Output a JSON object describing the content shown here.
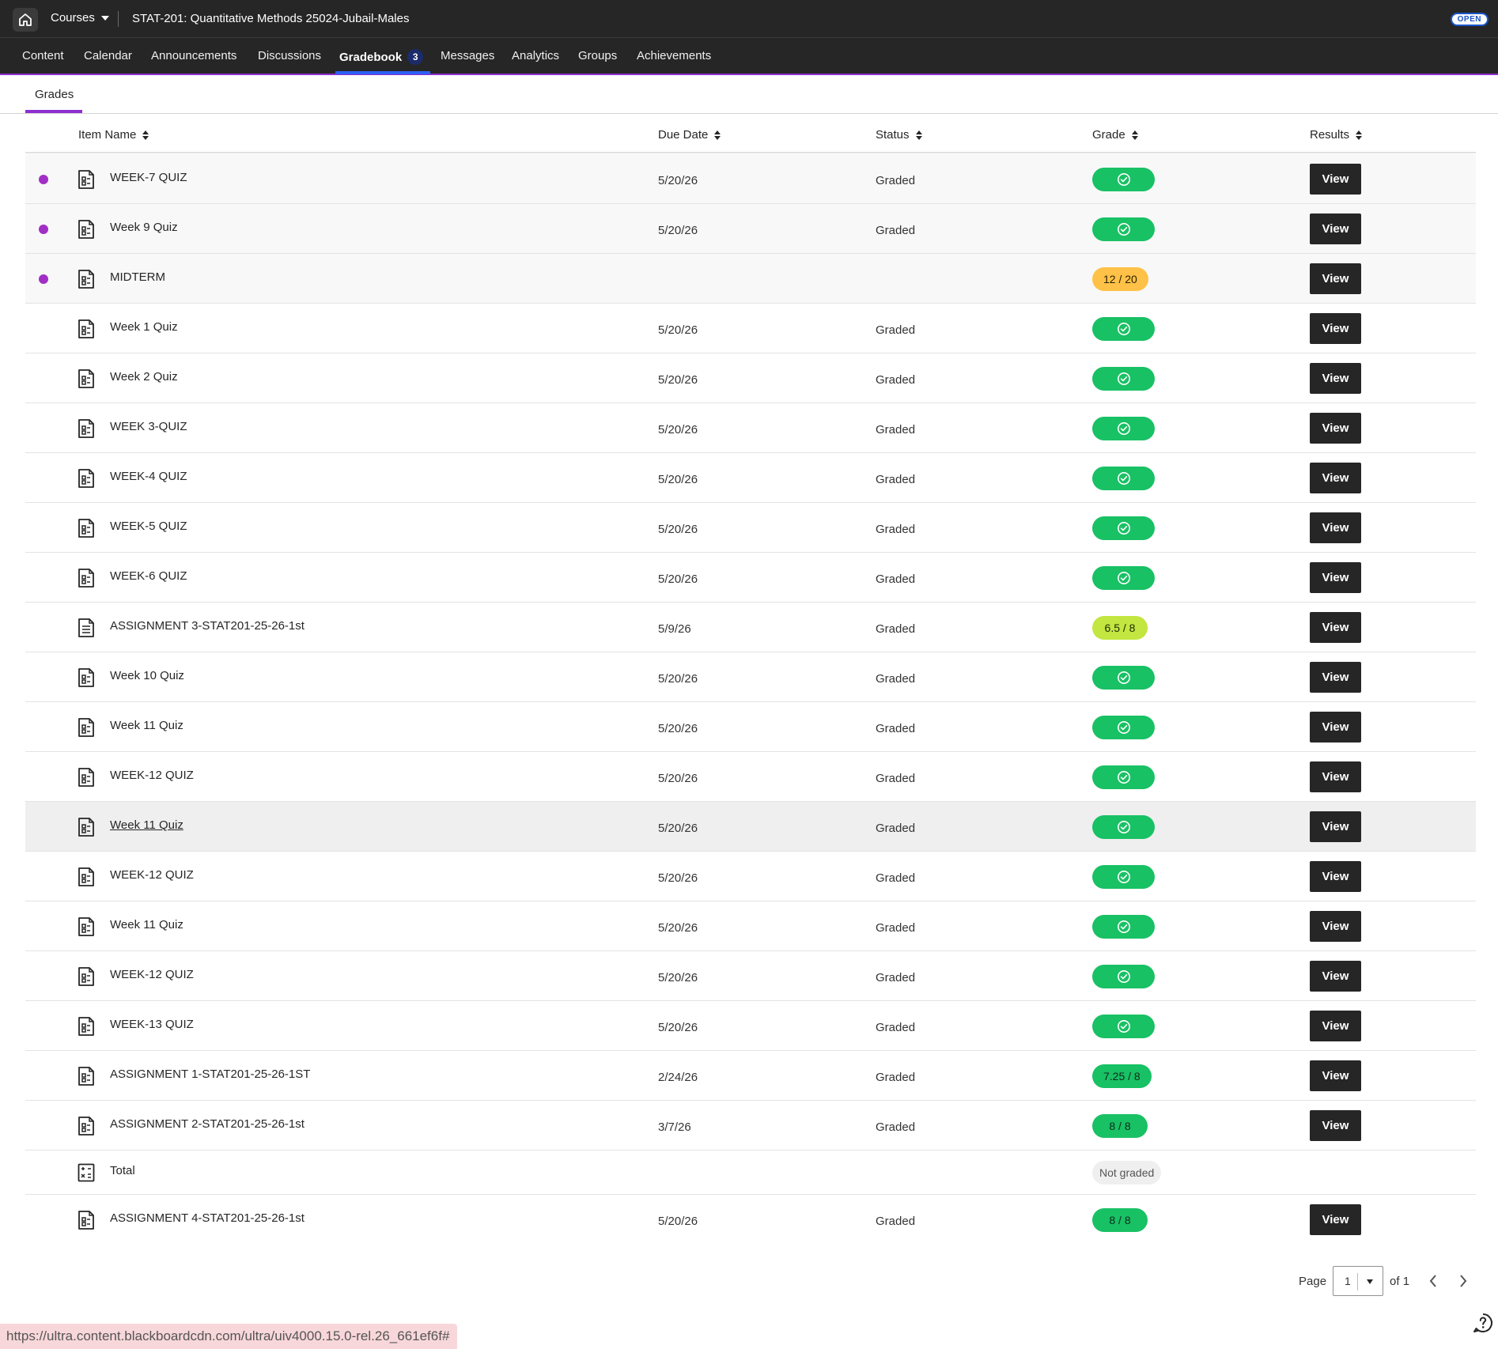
{
  "header": {
    "courses_label": "Courses",
    "course_title": "STAT-201: Quantitative Methods 25024-Jubail-Males",
    "open_badge": "OPEN"
  },
  "nav": {
    "items": [
      "Content",
      "Calendar",
      "Announcements",
      "Discussions",
      "Gradebook",
      "Messages",
      "Analytics",
      "Groups",
      "Achievements"
    ],
    "active": "Gradebook",
    "gradebook_badge": "3"
  },
  "subtabs": {
    "grades": "Grades"
  },
  "table": {
    "headers": {
      "item_name": "Item Name",
      "due_date": "Due Date",
      "status": "Status",
      "grade": "Grade",
      "results": "Results"
    },
    "rows": [
      {
        "name": "WEEK-7 QUIZ",
        "due": "5/20/26",
        "status": "Graded",
        "grade_type": "check",
        "new": true,
        "icon": "quiz-icon",
        "results": "View"
      },
      {
        "name": "Week 9 Quiz",
        "due": "5/20/26",
        "status": "Graded",
        "grade_type": "check",
        "new": true,
        "icon": "quiz-icon",
        "results": "View"
      },
      {
        "name": "MIDTERM",
        "due": "",
        "status": "",
        "grade_type": "score",
        "grade": "12 / 20",
        "grade_color": "orange",
        "new": true,
        "icon": "quiz-icon",
        "results": "View"
      },
      {
        "name": "Week 1 Quiz",
        "due": "5/20/26",
        "status": "Graded",
        "grade_type": "check",
        "icon": "quiz-icon",
        "results": "View"
      },
      {
        "name": "Week 2 Quiz",
        "due": "5/20/26",
        "status": "Graded",
        "grade_type": "check",
        "icon": "quiz-icon",
        "results": "View"
      },
      {
        "name": "WEEK 3-QUIZ",
        "due": "5/20/26",
        "status": "Graded",
        "grade_type": "check",
        "icon": "quiz-icon",
        "results": "View"
      },
      {
        "name": "WEEK-4 QUIZ",
        "due": "5/20/26",
        "status": "Graded",
        "grade_type": "check",
        "icon": "quiz-icon",
        "results": "View"
      },
      {
        "name": "WEEK-5 QUIZ",
        "due": "5/20/26",
        "status": "Graded",
        "grade_type": "check",
        "icon": "quiz-icon",
        "results": "View"
      },
      {
        "name": "WEEK-6 QUIZ",
        "due": "5/20/26",
        "status": "Graded",
        "grade_type": "check",
        "icon": "quiz-icon",
        "results": "View"
      },
      {
        "name": "ASSIGNMENT 3-STAT201-25-26-1st",
        "due": "5/9/26",
        "status": "Graded",
        "grade_type": "score",
        "grade": "6.5 / 8",
        "grade_color": "lime",
        "icon": "document-icon",
        "results": "View"
      },
      {
        "name": "Week 10 Quiz",
        "due": "5/20/26",
        "status": "Graded",
        "grade_type": "check",
        "icon": "quiz-icon",
        "results": "View"
      },
      {
        "name": "Week 11 Quiz",
        "due": "5/20/26",
        "status": "Graded",
        "grade_type": "check",
        "icon": "quiz-icon",
        "results": "View"
      },
      {
        "name": "WEEK-12 QUIZ",
        "due": "5/20/26",
        "status": "Graded",
        "grade_type": "check",
        "icon": "quiz-icon",
        "results": "View"
      },
      {
        "name": "Week 11 Quiz",
        "due": "5/20/26",
        "status": "Graded",
        "grade_type": "check",
        "hover": true,
        "icon": "quiz-icon",
        "results": "View"
      },
      {
        "name": "WEEK-12 QUIZ",
        "due": "5/20/26",
        "status": "Graded",
        "grade_type": "check",
        "icon": "quiz-icon",
        "results": "View"
      },
      {
        "name": "Week 11 Quiz",
        "due": "5/20/26",
        "status": "Graded",
        "grade_type": "check",
        "icon": "quiz-icon",
        "results": "View"
      },
      {
        "name": "WEEK-12 QUIZ",
        "due": "5/20/26",
        "status": "Graded",
        "grade_type": "check",
        "icon": "quiz-icon",
        "results": "View"
      },
      {
        "name": "WEEK-13 QUIZ",
        "due": "5/20/26",
        "status": "Graded",
        "grade_type": "check",
        "icon": "quiz-icon",
        "results": "View"
      },
      {
        "name": "ASSIGNMENT 1-STAT201-25-26-1ST",
        "due": "2/24/26",
        "status": "Graded",
        "grade_type": "score",
        "grade": "7.25 / 8",
        "grade_color": "green",
        "icon": "quiz-icon",
        "results": "View"
      },
      {
        "name": "ASSIGNMENT 2-STAT201-25-26-1st",
        "due": "3/7/26",
        "status": "Graded",
        "grade_type": "score",
        "grade": "8 / 8",
        "grade_color": "green",
        "icon": "quiz-icon",
        "results": "View"
      },
      {
        "name": "Total",
        "due": "",
        "status": "",
        "grade_type": "score",
        "grade": "Not graded",
        "grade_color": "grey",
        "icon": "calculator-icon",
        "results": "",
        "short": true
      },
      {
        "name": "ASSIGNMENT 4-STAT201-25-26-1st",
        "due": "5/20/26",
        "status": "Graded",
        "grade_type": "score",
        "grade": "8 / 8",
        "grade_color": "green",
        "icon": "quiz-icon",
        "results": "View"
      }
    ]
  },
  "pagination": {
    "page_label": "Page",
    "current": "1",
    "of_label": "of 1"
  },
  "statusbar": {
    "url": "https://ultra.content.blackboardcdn.com/ultra/uiv4000.15.0-rel.26_661ef6f#"
  },
  "colors": {
    "accent_purple": "#8d2ed1",
    "new_dot": "#a12fc5",
    "nav_active_underline": "#2f5ff5",
    "grade_green": "#18c164",
    "grade_orange": "#ffc147",
    "grade_lime": "#c3e640"
  }
}
